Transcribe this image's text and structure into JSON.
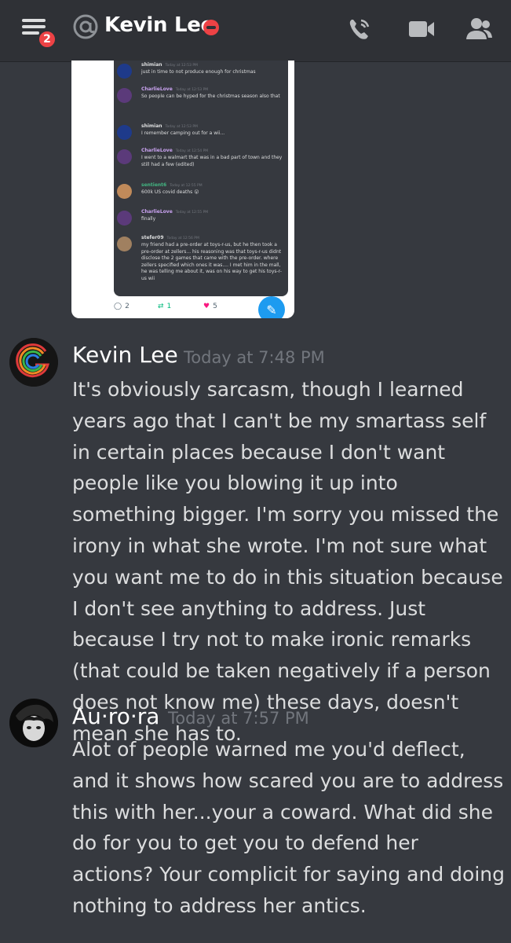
{
  "header": {
    "title": "Kevin Lee",
    "notification_count": "2",
    "icons": [
      "menu-icon",
      "at-icon",
      "do-not-disturb-icon",
      "call-icon",
      "video-icon",
      "members-icon"
    ]
  },
  "embed": {
    "messages": [
      {
        "author": "shimian",
        "time": "Today at 12:53 PM",
        "text": "just in time to not produce enough for christmas",
        "color": "#dcddde"
      },
      {
        "author": "CharlieLove",
        "time": "Today at 12:53 PM",
        "text": "So people can be hyped for the christmas season also that",
        "color": "#c9a2f0"
      },
      {
        "author": "shimian",
        "time": "Today at 12:53 PM",
        "text": "I remember camping out for a wii...",
        "color": "#dcddde"
      },
      {
        "author": "CharlieLove",
        "time": "Today at 12:54 PM",
        "text": "I went to a walmart that was in a bad part of town and they still had a few (edited)",
        "color": "#c9a2f0"
      },
      {
        "author": "sentient6",
        "time": "Today at 12:55 PM",
        "text": "600k US covid deaths 😮",
        "color": "#43b581"
      },
      {
        "author": "CharlieLove",
        "time": "Today at 12:55 PM",
        "text": "finally",
        "color": "#c9a2f0"
      },
      {
        "author": "stefer09",
        "time": "Today at 12:56 PM",
        "text": "my friend had a pre-order at toys-r-us, but he then took a pre-order at zellers... his reasoning was that toys-r-us didnt disclose the 2 games that came with the pre-order. where zellers specified which ones it was.... I met him in the mall, he was telling me about it, was on his way to get his toys-r-us wii",
        "color": "#dcddde"
      }
    ],
    "tweet_stats": {
      "replies": "2",
      "retweets": "1",
      "likes": "5"
    }
  },
  "messages": [
    {
      "author": "Kevin Lee",
      "timestamp": "Today at 7:48 PM",
      "text": "It's obviously sarcasm, though I learned years ago that I can't be my smartass self in certain places because I don't want people like you blowing it up into something bigger. I'm sorry you missed the irony in what she wrote. I'm not sure what you want me to do in this situation because I don't see anything to address. Just because I try not to make ironic remarks (that could be taken negatively if a person does not know me) these days, doesn't mean she has to."
    },
    {
      "author": "Au·ro·ra",
      "timestamp": "Today at 7:57 PM",
      "text": "Alot of people warned me you'd deflect, and it shows how scared you are to address this with her...your a coward. What did she do for you to get you to defend her actions? Your complicit for saying and doing nothing to address her antics."
    }
  ],
  "colors": {
    "background": "#36393f",
    "header": "#2f3136",
    "badge": "#ed4245",
    "author": "#ffffff",
    "timestamp": "#72767d"
  }
}
